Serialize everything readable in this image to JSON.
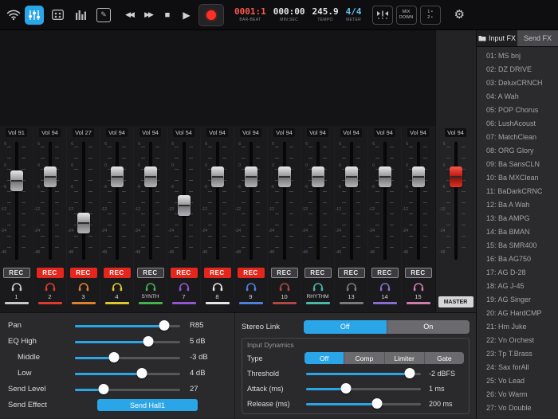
{
  "colors": {
    "accent_blue": "#2aa5e8",
    "rec_red": "#e5261d",
    "record_dot": "#ff2f26",
    "bar_beat_red": "#ff584c",
    "meter_blue": "#63c3f2"
  },
  "toolbar": {
    "counters": [
      {
        "value": "0001:1",
        "label": "BAR-BEAT",
        "color": "#ff584c"
      },
      {
        "value": "000:00",
        "label": "MIN:SEC",
        "color": "#e6e6ea"
      },
      {
        "value": "245.9",
        "label": "TEMPO",
        "color": "#e6e6ea"
      },
      {
        "value": "4/4",
        "label": "METER",
        "color": "#63c3f2"
      }
    ],
    "mixdown_lines": [
      "MIX",
      "DOWN"
    ],
    "click_lines": [
      "1 •",
      "2 •"
    ]
  },
  "mixer": {
    "rec_label": "REC",
    "scale_ticks": [
      "6",
      "0",
      "-6",
      "-12",
      "-24",
      "-48"
    ],
    "channels": [
      {
        "label": "1",
        "vol": "Vol 91",
        "fader_pct": 30,
        "rec_active": false,
        "color": "#c9c9c9"
      },
      {
        "label": "2",
        "vol": "Vol 94",
        "fader_pct": 26,
        "rec_active": true,
        "color": "#e03a30"
      },
      {
        "label": "3",
        "vol": "Vol 27",
        "fader_pct": 72,
        "rec_active": true,
        "color": "#e0802e"
      },
      {
        "label": "4",
        "vol": "Vol 94",
        "fader_pct": 26,
        "rec_active": true,
        "color": "#e0c62e"
      },
      {
        "label": "SYNTH",
        "vol": "Vol 94",
        "fader_pct": 26,
        "rec_active": false,
        "color": "#46b24e"
      },
      {
        "label": "7",
        "vol": "Vol 54",
        "fader_pct": 55,
        "rec_active": true,
        "color": "#9257d0"
      },
      {
        "label": "8",
        "vol": "Vol 94",
        "fader_pct": 26,
        "rec_active": true,
        "color": "#e6e6e6"
      },
      {
        "label": "9",
        "vol": "Vol 94",
        "fader_pct": 26,
        "rec_active": true,
        "color": "#4f7fd9"
      },
      {
        "label": "10",
        "vol": "Vol 94",
        "fader_pct": 26,
        "rec_active": false,
        "color": "#b0483f"
      },
      {
        "label": "RHYTHM",
        "vol": "Vol 94",
        "fader_pct": 26,
        "rec_active": false,
        "color": "#49b8a8"
      },
      {
        "label": "13",
        "vol": "Vol 94",
        "fader_pct": 26,
        "rec_active": false,
        "color": "#7a7a7e"
      },
      {
        "label": "14",
        "vol": "Vol 94",
        "fader_pct": 26,
        "rec_active": false,
        "color": "#8a6bd0"
      },
      {
        "label": "15",
        "vol": "Vol 94",
        "fader_pct": 26,
        "rec_active": false,
        "color": "#d07bb0"
      }
    ],
    "master": {
      "vol": "Vol 94",
      "label": "MASTER",
      "fader_pct": 26
    }
  },
  "inspector": {
    "left_rows": [
      {
        "label": "Pan",
        "value": "R85",
        "pct": 85,
        "indent": false
      },
      {
        "label": "EQ High",
        "value": "5 dB",
        "pct": 70,
        "indent": false
      },
      {
        "label": "Middle",
        "value": "-3 dB",
        "pct": 37,
        "indent": true
      },
      {
        "label": "Low",
        "value": "4 dB",
        "pct": 64,
        "indent": true
      },
      {
        "label": "Send Level",
        "value": "27",
        "pct": 27,
        "indent": false
      }
    ],
    "send_effect": {
      "label": "Send Effect",
      "button_label": "Send Hall1"
    },
    "stereo_link": {
      "label": "Stereo Link",
      "options": [
        "Off",
        "On"
      ],
      "selected": 0
    },
    "dynamics": {
      "title": "Input Dynamics",
      "type": {
        "label": "Type",
        "options": [
          "Off",
          "Comp",
          "Limiter",
          "Gate"
        ],
        "selected": 0
      },
      "sliders": [
        {
          "label": "Threshold",
          "value": "-2 dBFS",
          "pct": 90
        },
        {
          "label": "Attack (ms)",
          "value": "1 ms",
          "pct": 35
        },
        {
          "label": "Release (ms)",
          "value": "200 ms",
          "pct": 62
        }
      ]
    }
  },
  "fx_panel": {
    "tabs": [
      {
        "label": "Input FX",
        "active": true
      },
      {
        "label": "Send FX",
        "active": false
      }
    ],
    "items": [
      "01: MS bnj",
      "02: DZ DRIVE",
      "03: DeluxCRNCH",
      "04: A Wah",
      "05: POP Chorus",
      "06: LushAcoust",
      "07: MatchClean",
      "08: ORG Glory",
      "09: Ba SansCLN",
      "10: Ba MXClean",
      "11: BaDarkCRNC",
      "12: Ba A Wah",
      "13: Ba AMPG",
      "14: Ba BMAN",
      "15: Ba SMR400",
      "16: Ba AG750",
      "17: AG D-28",
      "18: AG J-45",
      "19: AG Singer",
      "20: AG HardCMP",
      "21: Hm Juke",
      "22: Vn Orchest",
      "23: Tp T.Brass",
      "24: Sax forAll",
      "25: Vo Lead",
      "26: Vo Warm",
      "27: Vo Double"
    ]
  }
}
